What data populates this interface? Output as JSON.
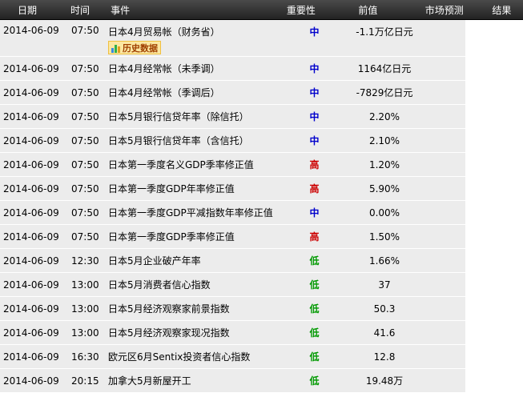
{
  "header": {
    "date": "日期",
    "time": "时间",
    "event": "事件",
    "importance": "重要性",
    "previous": "前值",
    "forecast": "市场预测",
    "result": "结果"
  },
  "history_button": "历史数据",
  "colors": {
    "mid": "#0000cc",
    "high": "#cc0000",
    "low": "#009900"
  },
  "rows": [
    {
      "date": "2014-06-09",
      "time": "07:50",
      "event": "日本4月贸易帐（财务省）",
      "importance": "中",
      "previous": "-1.1万亿日元"
    },
    {
      "date": "2014-06-09",
      "time": "07:50",
      "event": "日本4月经常帐（未季调）",
      "importance": "中",
      "previous": "1164亿日元"
    },
    {
      "date": "2014-06-09",
      "time": "07:50",
      "event": "日本4月经常帐（季调后）",
      "importance": "中",
      "previous": "-7829亿日元"
    },
    {
      "date": "2014-06-09",
      "time": "07:50",
      "event": "日本5月银行信贷年率（除信托）",
      "importance": "中",
      "previous": "2.20%"
    },
    {
      "date": "2014-06-09",
      "time": "07:50",
      "event": "日本5月银行信贷年率（含信托）",
      "importance": "中",
      "previous": "2.10%"
    },
    {
      "date": "2014-06-09",
      "time": "07:50",
      "event": "日本第一季度名义GDP季率修正值",
      "importance": "高",
      "previous": "1.20%"
    },
    {
      "date": "2014-06-09",
      "time": "07:50",
      "event": "日本第一季度GDP年率修正值",
      "importance": "高",
      "previous": "5.90%"
    },
    {
      "date": "2014-06-09",
      "time": "07:50",
      "event": "日本第一季度GDP平减指数年率修正值",
      "importance": "中",
      "previous": "0.00%"
    },
    {
      "date": "2014-06-09",
      "time": "07:50",
      "event": "日本第一季度GDP季率修正值",
      "importance": "高",
      "previous": "1.50%"
    },
    {
      "date": "2014-06-09",
      "time": "12:30",
      "event": "日本5月企业破产年率",
      "importance": "低",
      "previous": "1.66%"
    },
    {
      "date": "2014-06-09",
      "time": "13:00",
      "event": "日本5月消费者信心指数",
      "importance": "低",
      "previous": "37"
    },
    {
      "date": "2014-06-09",
      "time": "13:00",
      "event": "日本5月经济观察家前景指数",
      "importance": "低",
      "previous": "50.3"
    },
    {
      "date": "2014-06-09",
      "time": "13:00",
      "event": "日本5月经济观察家现况指数",
      "importance": "低",
      "previous": "41.6"
    },
    {
      "date": "2014-06-09",
      "time": "16:30",
      "event": "欧元区6月Sentix投资者信心指数",
      "importance": "低",
      "previous": "12.8"
    },
    {
      "date": "2014-06-09",
      "time": "20:15",
      "event": "加拿大5月新屋开工",
      "importance": "低",
      "previous": "19.48万"
    }
  ]
}
